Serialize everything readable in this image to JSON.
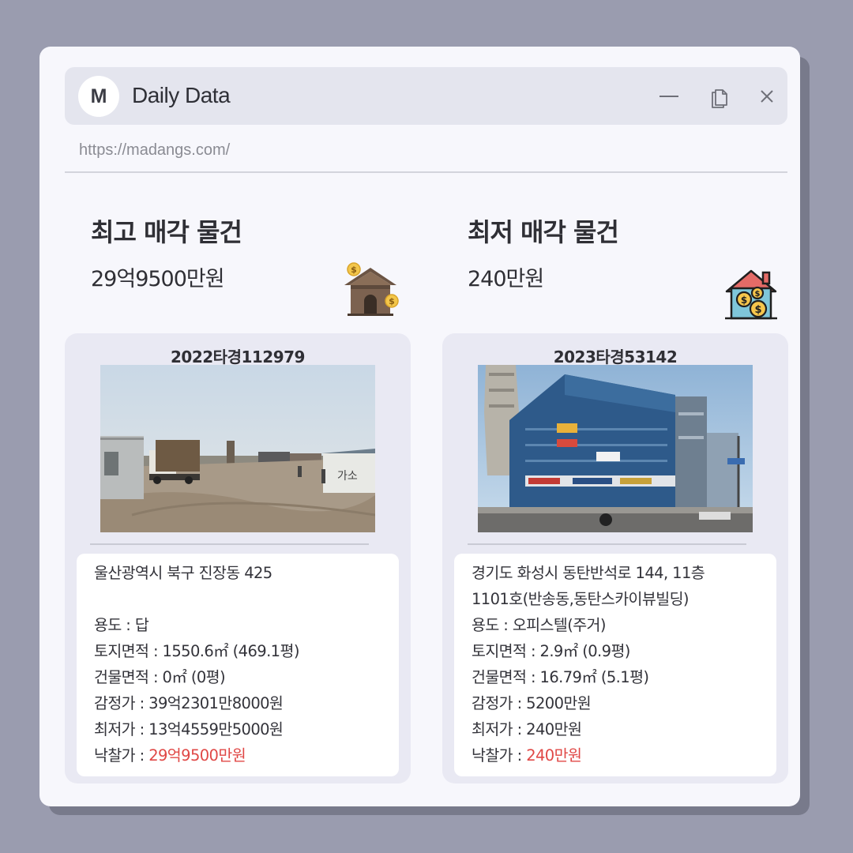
{
  "window": {
    "logo_letter": "M",
    "title": "Daily Data",
    "url": "https://madangs.com/"
  },
  "highest": {
    "heading": "최고 매각 물건",
    "amount": "29억9500만원",
    "icon": "house-with-coins-icon",
    "case_no": "2022타경112979",
    "photo": "construction-site-photo",
    "address": "울산광역시 북구 진장동 425",
    "usage": "용도 : 답",
    "land_area": "토지면적 : 1550.6㎡ (469.1평)",
    "building_area": "건물면적 : 0㎡ (0평)",
    "appraisal": "감정가 : 39억2301만8000원",
    "minimum": "최저가 : 13억4559만5000원",
    "winning_label": "낙찰가 : ",
    "winning_value": "29억9500만원"
  },
  "lowest": {
    "heading": "최저 매각 물건",
    "amount": "240만원",
    "icon": "house-money-icon",
    "case_no": "2023타경53142",
    "photo": "city-building-photo",
    "address_line1": "경기도 화성시 동탄반석로 144, 11층",
    "address_line2": "1101호(반송동,동탄스카이뷰빌딩)",
    "usage": "용도 : 오피스텔(주거)",
    "land_area": "토지면적 : 2.9㎡ (0.9평)",
    "building_area": "건물면적 : 16.79㎡ (5.1평)",
    "appraisal": "감정가 : 5200만원",
    "minimum": "최저가 : 240만원",
    "winning_label": "낙찰가 : ",
    "winning_value": "240만원"
  },
  "colors": {
    "background": "#9a9caf",
    "window": "#f7f7fc",
    "titlebar": "#e4e5ee",
    "card": "#e9e9f3",
    "highlight": "#e04846"
  }
}
